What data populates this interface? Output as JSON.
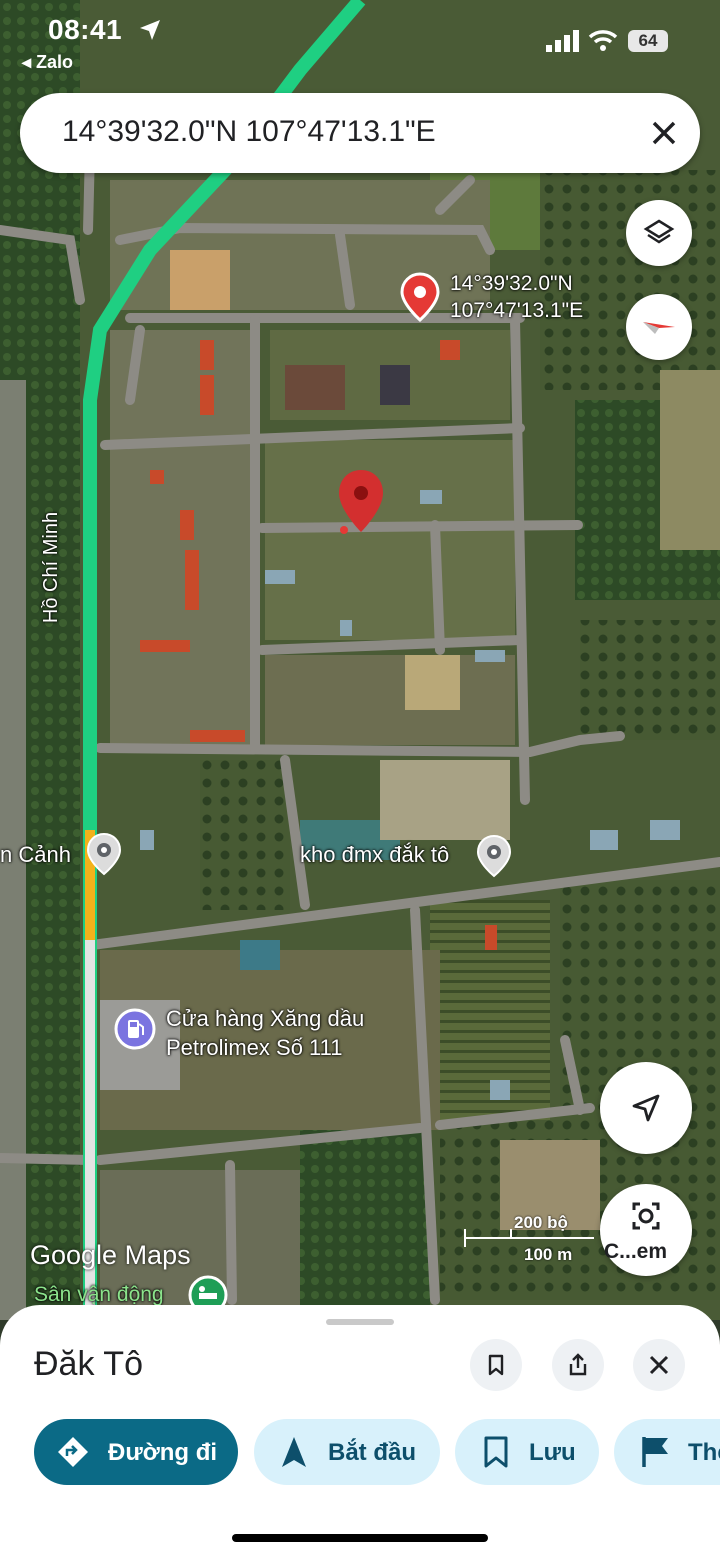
{
  "status_bar": {
    "time": "08:41",
    "back_app": "◂ Zalo",
    "battery": "64"
  },
  "search": {
    "query": "14°39'32.0\"N 107°47'13.1\"E"
  },
  "map": {
    "pin_label_line1": "14°39'32.0\"N",
    "pin_label_line2": "107°47'13.1\"E",
    "road_label": "Hồ Chí Minh",
    "poi_left": "n Cảnh",
    "poi_right": "kho đmx đắk tô",
    "gas_line1": "Cửa hàng Xăng dầu",
    "gas_line2": "Petrolimex Số 111",
    "stadium": "Sân vận động",
    "logo": "Google Maps",
    "scale_top": "200 bộ",
    "scale_bottom": "100 m",
    "camera_label": "C...em"
  },
  "sheet": {
    "title": "Đăk Tô",
    "chips": {
      "directions": "Đường đi",
      "start": "Bắt đầu",
      "save": "Lưu",
      "more": "Thê"
    }
  },
  "colors": {
    "accent": "#0b6a86",
    "chip_bg": "#d8f1fb",
    "pin_red": "#e53935",
    "route_green": "#1fcf82"
  }
}
